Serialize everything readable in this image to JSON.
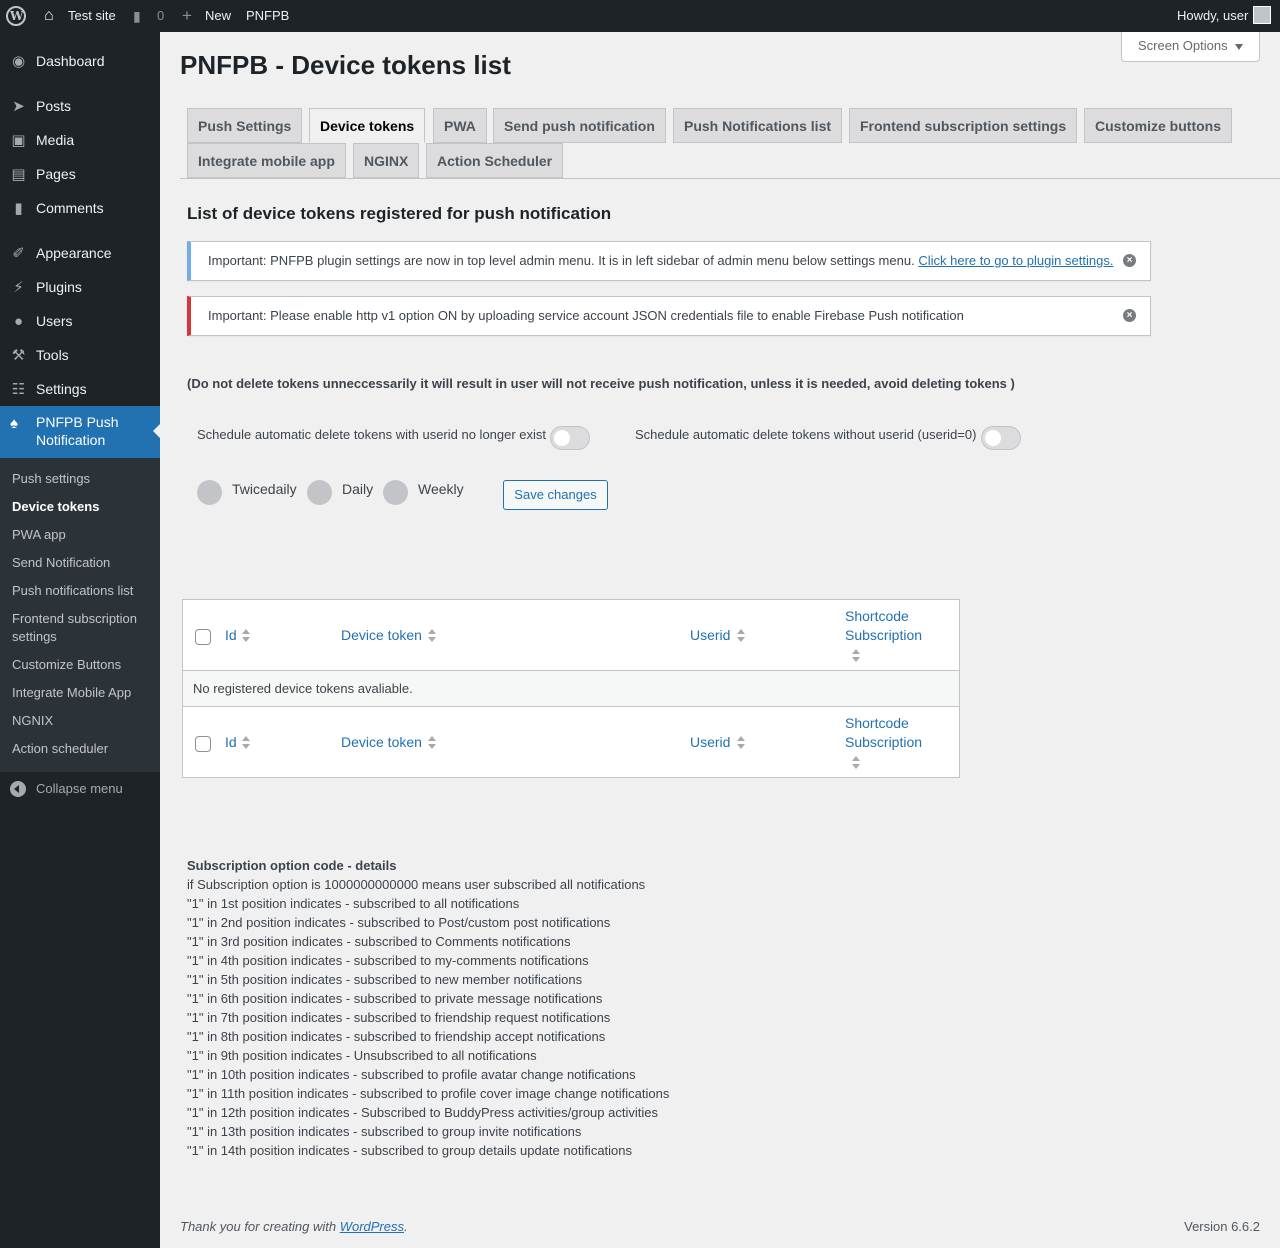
{
  "adminbar": {
    "site_name": "Test site",
    "comments_count": "0",
    "new_label": "New",
    "plugin_label": "PNFPB",
    "greeting": "Howdy, user"
  },
  "sidebar": {
    "items": [
      {
        "label": "Dashboard",
        "icon": "dashboard-icon"
      },
      {
        "label": "Posts",
        "icon": "pin-icon"
      },
      {
        "label": "Media",
        "icon": "media-icon"
      },
      {
        "label": "Pages",
        "icon": "pages-icon"
      },
      {
        "label": "Comments",
        "icon": "comment-icon"
      },
      {
        "label": "Appearance",
        "icon": "brush-icon"
      },
      {
        "label": "Plugins",
        "icon": "plug-icon"
      },
      {
        "label": "Users",
        "icon": "user-icon"
      },
      {
        "label": "Tools",
        "icon": "wrench-icon"
      },
      {
        "label": "Settings",
        "icon": "sliders-icon"
      }
    ],
    "active": {
      "label": "PNFPB Push Notification",
      "icon": "bell-icon"
    },
    "submenu": [
      "Push settings",
      "Device tokens",
      "PWA app",
      "Send Notification",
      "Push notifications list",
      "Frontend subscription settings",
      "Customize Buttons",
      "Integrate Mobile App",
      "NGNIX",
      "Action scheduler"
    ],
    "collapse_label": "Collapse menu"
  },
  "screen_options": "Screen Options",
  "page_title": "PNFPB - Device tokens list",
  "tabs": [
    "Push Settings",
    "Device tokens",
    "PWA",
    "Send push notification",
    "Push Notifications list",
    "Frontend subscription settings",
    "Customize buttons",
    "Integrate mobile app",
    "NGINX",
    "Action Scheduler"
  ],
  "section_title": "List of device tokens registered for push notification",
  "notice_info": {
    "text": "Important: PNFPB plugin settings are now in top level admin menu. It is in left sidebar of admin menu below settings menu.",
    "link": "Click here to go to plugin settings."
  },
  "notice_error": {
    "text": "Important: Please enable http v1 option ON by uploading service account JSON credentials file to enable Firebase Push notification"
  },
  "warning": "(Do not delete tokens unneccessarily it will result in user will not receive push notification, unless it is needed, avoid deleting tokens )",
  "toggles": {
    "label1": "Schedule automatic delete tokens with userid no longer exist",
    "label2": "Schedule automatic delete tokens without userid (userid=0)"
  },
  "schedule": {
    "options": [
      "Twicedaily",
      "Daily",
      "Weekly"
    ],
    "save_label": "Save changes"
  },
  "table": {
    "columns": [
      "Id",
      "Device token",
      "Userid",
      "Shortcode Subscription"
    ],
    "empty": "No registered device tokens avaliable."
  },
  "details": {
    "title": "Subscription option code - details",
    "lines": [
      "if Subscription option is 1000000000000 means user subscribed all notifications",
      "\"1\" in 1st position indicates - subscribed to all notifications",
      "\"1\" in 2nd position indicates - subscribed to Post/custom post notifications",
      "\"1\" in 3rd position indicates - subscribed to Comments notifications",
      "\"1\" in 4th position indicates - subscribed to my-comments notifications",
      "\"1\" in 5th position indicates - subscribed to new member notifications",
      "\"1\" in 6th position indicates - subscribed to private message notifications",
      "\"1\" in 7th position indicates - subscribed to friendship request notifications",
      "\"1\" in 8th position indicates - subscribed to friendship accept notifications",
      "\"1\" in 9th position indicates - Unsubscribed to all notifications",
      "\"1\" in 10th position indicates - subscribed to profile avatar change notifications",
      "\"1\" in 11th position indicates - subscribed to profile cover image change notifications",
      "\"1\" in 12th position indicates - Subscribed to BuddyPress activities/group activities",
      "\"1\" in 13th position indicates - subscribed to group invite notifications",
      "\"1\" in 14th position indicates - subscribed to group details update notifications"
    ]
  },
  "footer": {
    "thanks": "Thank you for creating with",
    "link": "WordPress",
    "dot": ".",
    "version": "Version 6.6.2"
  }
}
